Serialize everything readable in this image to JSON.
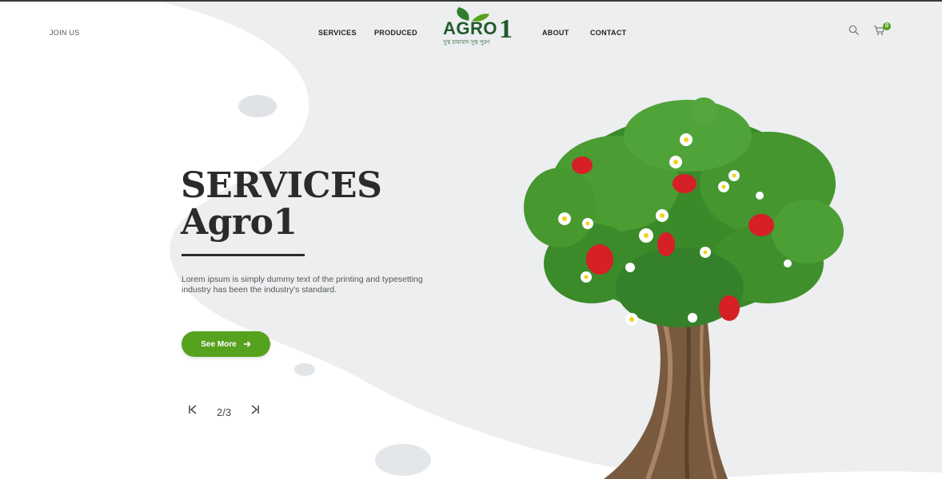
{
  "header": {
    "join_label": "JOIN US",
    "nav": [
      "SERVICES",
      "PRODUCED",
      "ABOUT",
      "CONTACT"
    ],
    "logo": {
      "word": "AGRO",
      "number": "1",
      "tagline": "সুস্থ চাষাবাদ সুস্থ পুরণ"
    },
    "cart_count": "0",
    "icons": [
      "search-icon",
      "cart-icon"
    ]
  },
  "hero": {
    "title_line1": "SERVICES",
    "title_line2": "Agro1",
    "description": "Lorem ipsum is simply dummy text of the printing and typesetting industry has been the industry's standard.",
    "button_label": "See More",
    "button_icon": "arrow-right-icon"
  },
  "slider": {
    "current": "2",
    "separator": "/",
    "total": "3"
  },
  "colors": {
    "accent": "#56a21e",
    "logo_green": "#1f5c2a",
    "text_dark": "#2b2b2b"
  }
}
